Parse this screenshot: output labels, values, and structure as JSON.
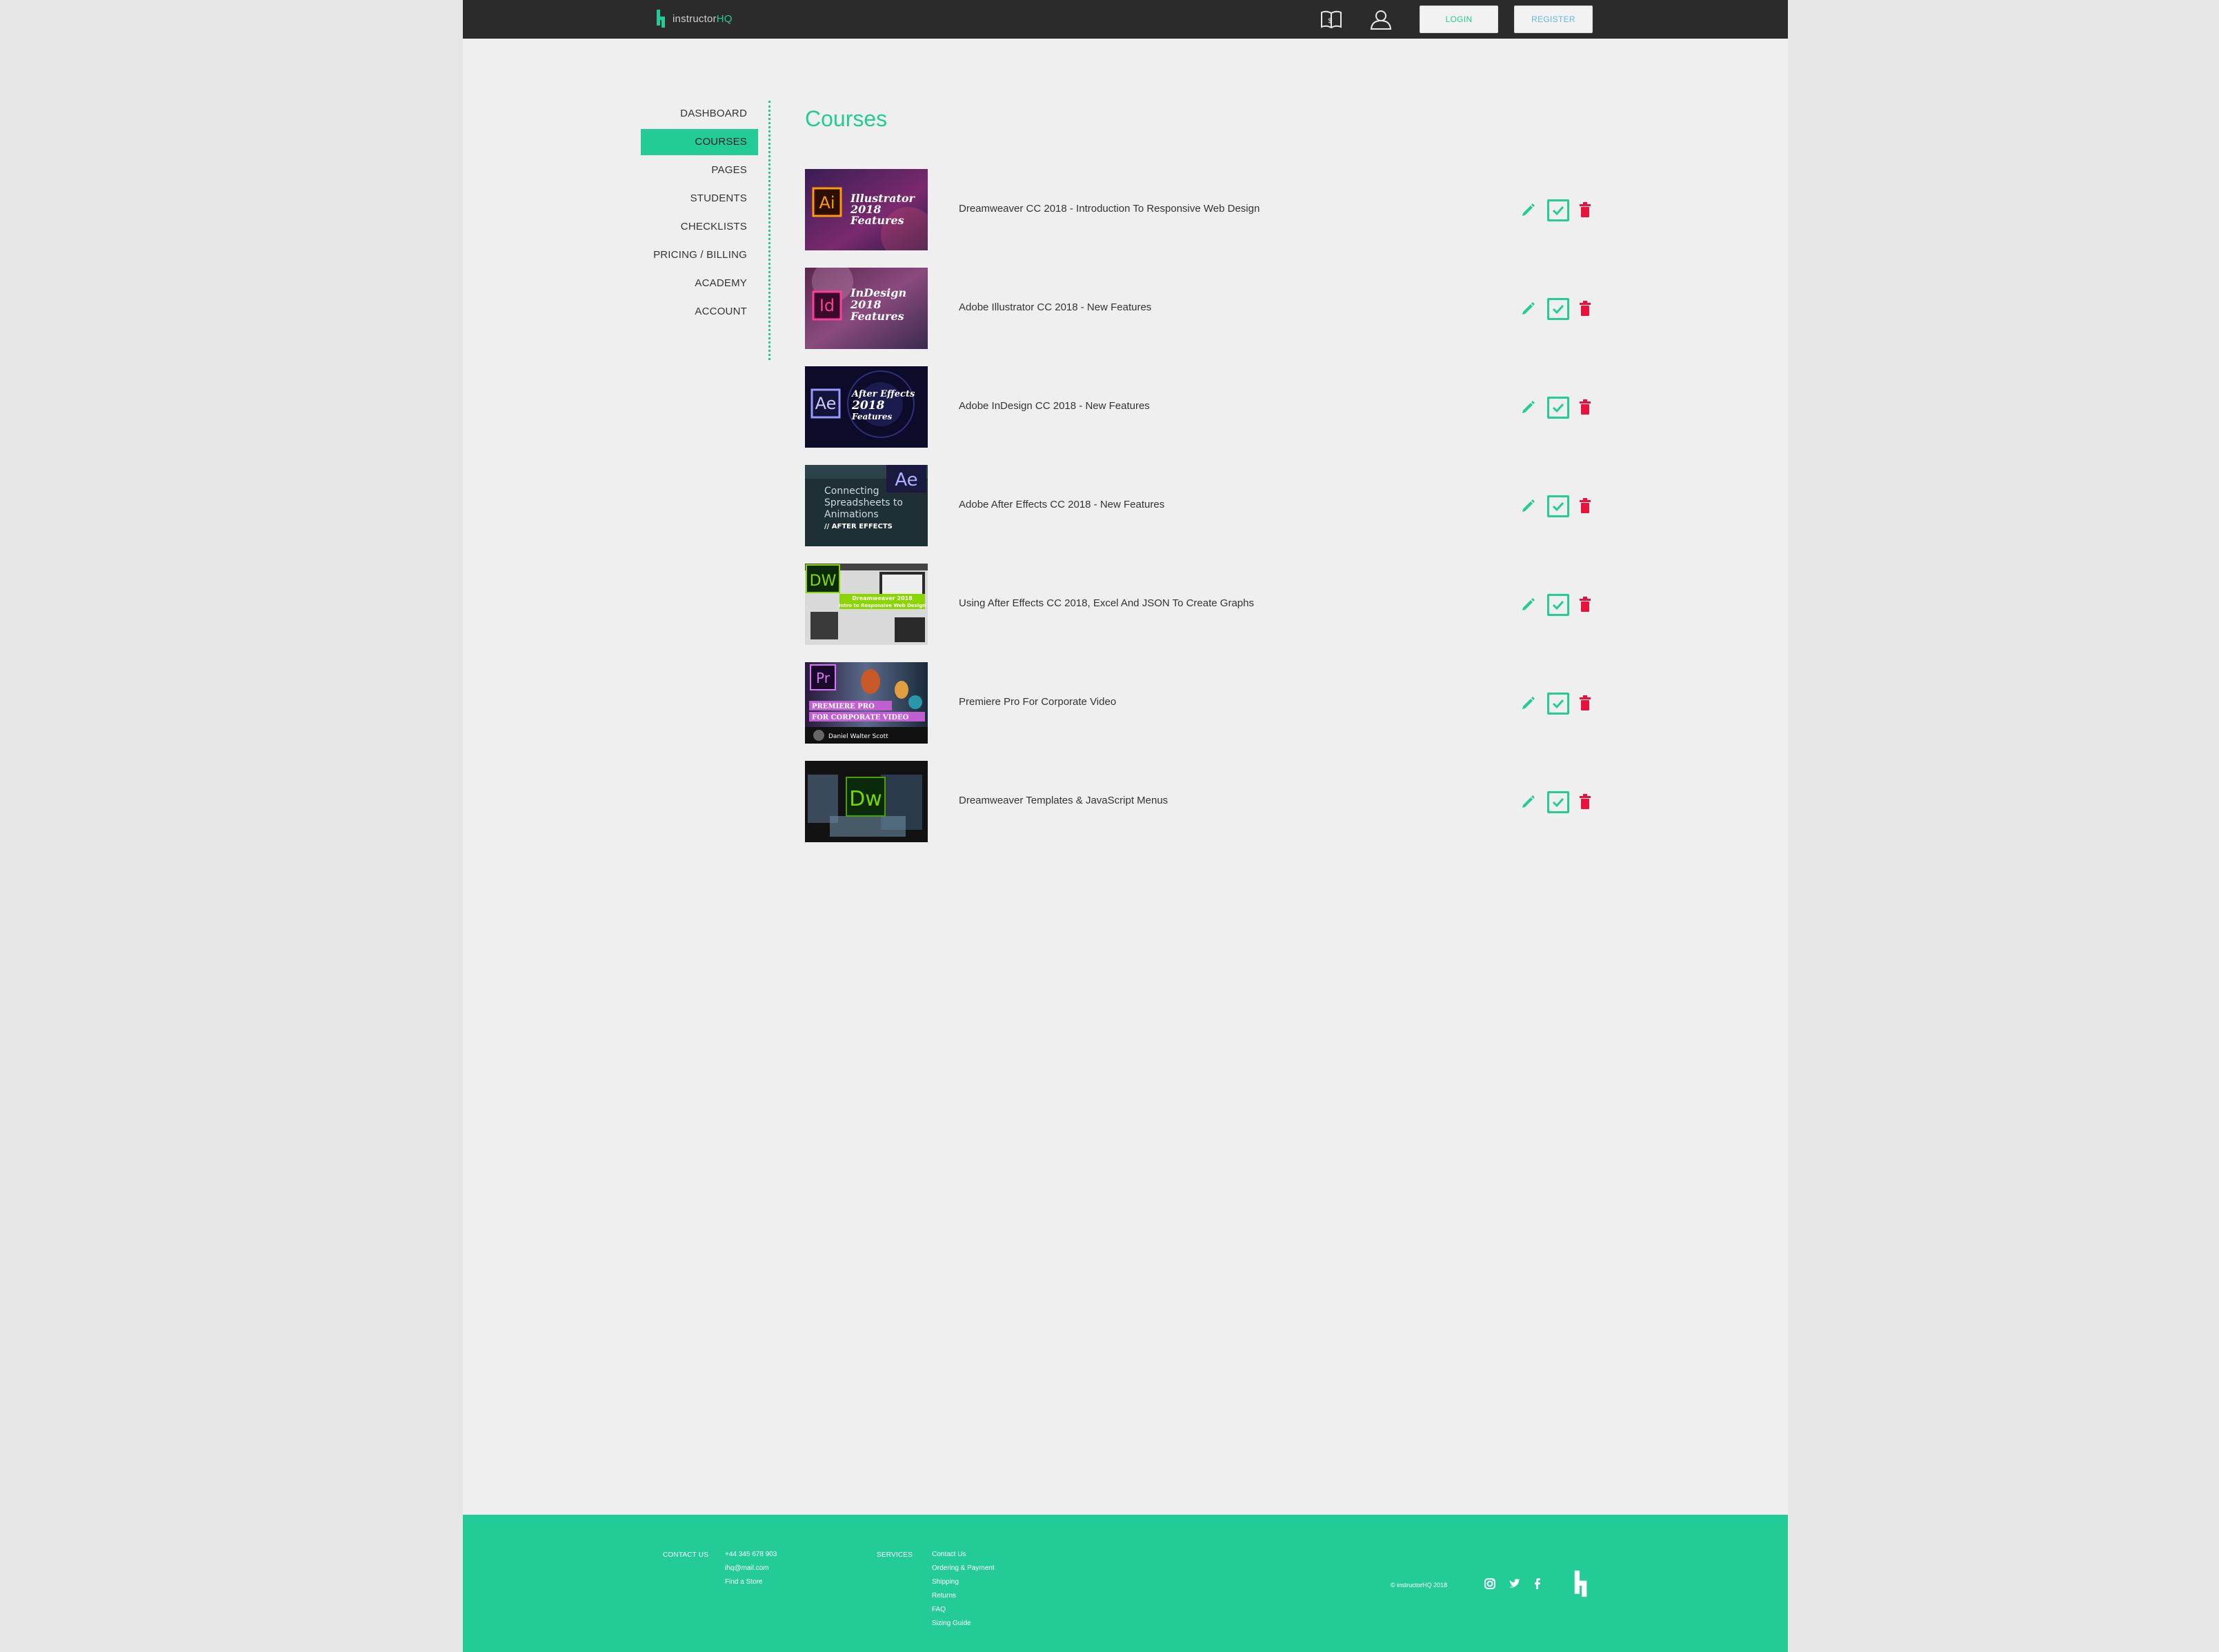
{
  "header": {
    "logo_prefix": "instructor",
    "logo_suffix": "HQ",
    "login_label": "LOGIN",
    "register_label": "REGISTER"
  },
  "sidebar": {
    "items": [
      {
        "label": "DASHBOARD"
      },
      {
        "label": "COURSES"
      },
      {
        "label": "PAGES"
      },
      {
        "label": "STUDENTS"
      },
      {
        "label": "CHECKLISTS"
      },
      {
        "label": "PRICING / BILLING"
      },
      {
        "label": "ACADEMY"
      },
      {
        "label": "ACCOUNT"
      }
    ],
    "active_index": 1
  },
  "main": {
    "title": "Courses",
    "courses": [
      {
        "title": "Dreamweaver CC 2018 - Introduction To Responsive Web Design",
        "thumb": {
          "badge": "Ai",
          "lines": [
            "Illustrator",
            "2018",
            "Features"
          ]
        }
      },
      {
        "title": "Adobe Illustrator CC 2018 - New Features",
        "thumb": {
          "badge": "Id",
          "lines": [
            "InDesign",
            "2018",
            "Features"
          ]
        }
      },
      {
        "title": "Adobe InDesign CC 2018 - New Features",
        "thumb": {
          "badge": "Ae",
          "lines": [
            "After Effects",
            "2018",
            "Features"
          ]
        }
      },
      {
        "title": "Adobe After Effects CC 2018 - New Features",
        "thumb": {
          "badge": "Ae",
          "lines": [
            "Connecting",
            "Spreadsheets to",
            "Animations",
            "// AFTER EFFECTS"
          ]
        }
      },
      {
        "title": "Using After Effects CC 2018, Excel And JSON To Create Graphs",
        "thumb": {
          "badge": "DW",
          "lines": [
            "Dreamweaver 2018",
            "Intro to Responsive Web Design"
          ]
        }
      },
      {
        "title": "Premiere Pro For Corporate Video",
        "thumb": {
          "badge": "Pr",
          "lines": [
            "PREMIERE PRO",
            "FOR CORPORATE VIDEO",
            "Daniel Walter Scott"
          ]
        }
      },
      {
        "title": "Dreamweaver Templates & JavaScript Menus",
        "thumb": {
          "badge": "Dw",
          "lines": []
        }
      }
    ]
  },
  "footer": {
    "contact_label": "CONTACT US",
    "contact_items": [
      "+44 345 678 903",
      "ihq@mail.com",
      "Find a Store"
    ],
    "services_label": "SERVICES",
    "services_items": [
      "Contact Us",
      "Ordering & Payment",
      "Shipping",
      "Returns",
      "FAQ",
      "Sizing Guide"
    ],
    "copyright": "© instructorHQ 2018"
  },
  "colors": {
    "accent": "#23cc97",
    "delete": "#e8123c",
    "header_bg": "#2b2b2b",
    "page_bg": "#efefef"
  },
  "icons": [
    "logo-mark-icon",
    "book-icon",
    "user-icon",
    "pencil-icon",
    "check-icon",
    "trash-icon",
    "instagram-icon",
    "twitter-icon",
    "facebook-icon"
  ]
}
